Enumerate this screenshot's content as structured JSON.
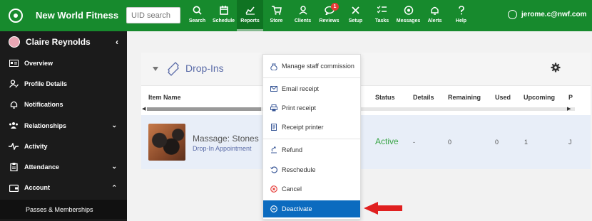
{
  "app": {
    "brand": "New World Fitness",
    "search_placeholder": "UID search",
    "user_email": "jerome.c@nwf.com"
  },
  "nav": [
    {
      "label": "Search",
      "icon": "search-icon"
    },
    {
      "label": "Schedule",
      "icon": "calendar-icon"
    },
    {
      "label": "Reports",
      "icon": "chart-icon",
      "active": true
    },
    {
      "label": "Store",
      "icon": "cart-icon"
    },
    {
      "label": "Clients",
      "icon": "person-icon"
    },
    {
      "label": "Reviews",
      "icon": "chat-icon",
      "badge": "1"
    },
    {
      "label": "Setup",
      "icon": "tools-icon"
    },
    {
      "label": "Tasks",
      "icon": "checklist-icon"
    },
    {
      "label": "Messages",
      "icon": "messages-icon"
    },
    {
      "label": "Alerts",
      "icon": "bell-icon"
    },
    {
      "label": "Help",
      "icon": "help-icon"
    }
  ],
  "sidebar": {
    "client_name": "Claire Reynolds",
    "items": [
      {
        "label": "Overview",
        "icon": "id-card-icon"
      },
      {
        "label": "Profile Details",
        "icon": "user-edit-icon"
      },
      {
        "label": "Notifications",
        "icon": "bell-icon"
      },
      {
        "label": "Relationships",
        "icon": "group-icon",
        "chevron": "down"
      },
      {
        "label": "Activity",
        "icon": "pulse-icon"
      },
      {
        "label": "Attendance",
        "icon": "clipboard-icon",
        "chevron": "down"
      },
      {
        "label": "Account",
        "icon": "wallet-icon",
        "chevron": "up"
      }
    ],
    "sub_item": "Passes & Memberships"
  },
  "panel": {
    "title": "Drop-Ins",
    "columns": [
      "Item Name",
      "Status",
      "Details",
      "Remaining",
      "Used",
      "Upcoming",
      "P"
    ],
    "row": {
      "name": "Massage: Stones",
      "type": "Drop-In Appointment",
      "status": "Active",
      "details": "-",
      "remaining": "0",
      "used": "0",
      "upcoming": "1",
      "extra": "J"
    }
  },
  "menu": [
    {
      "label": "Manage staff commission",
      "icon": "money-bag-icon"
    },
    {
      "label": "Email receipt",
      "icon": "email-icon"
    },
    {
      "label": "Print receipt",
      "icon": "printer-icon"
    },
    {
      "label": "Receipt printer",
      "icon": "receipt-icon"
    },
    {
      "label": "Refund",
      "icon": "refund-icon"
    },
    {
      "label": "Reschedule",
      "icon": "reschedule-icon"
    },
    {
      "label": "Cancel",
      "icon": "cancel-icon"
    },
    {
      "label": "Deactivate",
      "icon": "deactivate-icon",
      "selected": true
    }
  ],
  "colors": {
    "brand_green": "#178a2d",
    "sidebar_bg": "#1b1b1b",
    "selected_blue": "#0b6bbf",
    "active_green": "#3aa547",
    "annotation_red": "#e02020"
  }
}
